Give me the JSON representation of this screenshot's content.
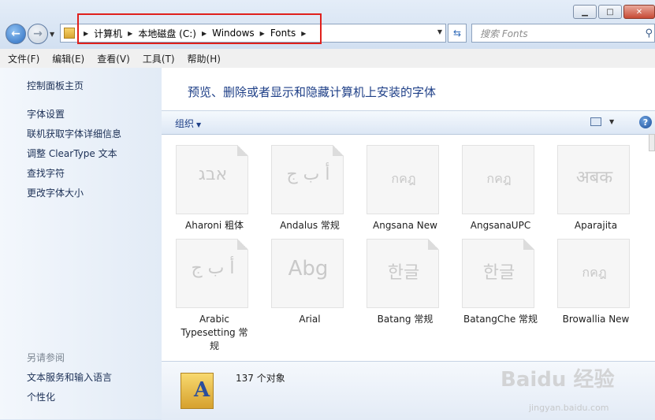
{
  "breadcrumb": [
    "计算机",
    "本地磁盘 (C:)",
    "Windows",
    "Fonts"
  ],
  "search": {
    "placeholder": "搜索 Fonts"
  },
  "menu": [
    "文件(F)",
    "编辑(E)",
    "查看(V)",
    "工具(T)",
    "帮助(H)"
  ],
  "leftpane": {
    "home": "控制面板主页",
    "links": [
      "字体设置",
      "联机获取字体详细信息",
      "调整 ClearType 文本",
      "查找字符",
      "更改字体大小"
    ],
    "see_also_heading": "另请参阅",
    "see_also": [
      "文本服务和输入语言",
      "个性化"
    ]
  },
  "main": {
    "title": "预览、删除或者显示和隐藏计算机上安装的字体",
    "organize_label": "组织",
    "help_label": "?"
  },
  "fonts": [
    {
      "name": "Aharoni 粗体",
      "sample": "אבג"
    },
    {
      "name": "Andalus 常规",
      "sample": "أ ب ج"
    },
    {
      "name": "Angsana New",
      "sample": "กคฎ"
    },
    {
      "name": "AngsanaUPC",
      "sample": "กคฎ"
    },
    {
      "name": "Aparajita",
      "sample": "अबक"
    },
    {
      "name": "Arabic Typesetting 常规",
      "sample": "أ ب ج"
    },
    {
      "name": "Arial",
      "sample": "Abg"
    },
    {
      "name": "Batang 常规",
      "sample": "한글"
    },
    {
      "name": "BatangChe 常规",
      "sample": "한글"
    },
    {
      "name": "Browallia New",
      "sample": "กคฎ"
    }
  ],
  "details": {
    "count": "137 个对象"
  },
  "watermark": {
    "text": "Baidu 经验",
    "url": "jingyan.baidu.com"
  },
  "colors": {
    "highlight_box": "#e0201c",
    "title": "#1e3f87"
  }
}
